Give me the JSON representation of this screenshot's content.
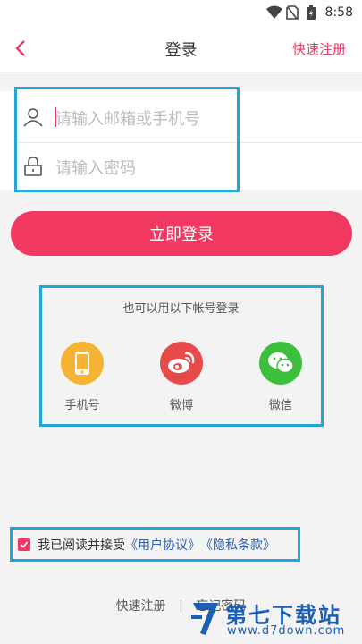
{
  "status_bar": {
    "time": "8:58"
  },
  "header": {
    "title": "登录",
    "register": "快速注册"
  },
  "form": {
    "account_placeholder": "请输入邮箱或手机号",
    "password_placeholder": "请输入密码"
  },
  "login_button": "立即登录",
  "social": {
    "title": "也可以用以下帐号登录",
    "items": [
      {
        "label": "手机号",
        "icon": "phone-icon",
        "color": "#f5b335"
      },
      {
        "label": "微博",
        "icon": "weibo-icon",
        "color": "#e84a4a"
      },
      {
        "label": "微信",
        "icon": "wechat-icon",
        "color": "#3cbf3c"
      }
    ]
  },
  "agreement": {
    "checked": true,
    "text": "我已阅读并接受",
    "user_agreement": "《用户协议》",
    "privacy": "《隐私条款》"
  },
  "bottom": {
    "register": "快速注册",
    "separator": "|",
    "forgot": "忘记密码"
  },
  "watermark": {
    "name": "第七下载站",
    "url": "www.d7down.com"
  },
  "colors": {
    "accent": "#f03861",
    "link": "#2b5fb5",
    "annotation": "#1fa7d6"
  }
}
